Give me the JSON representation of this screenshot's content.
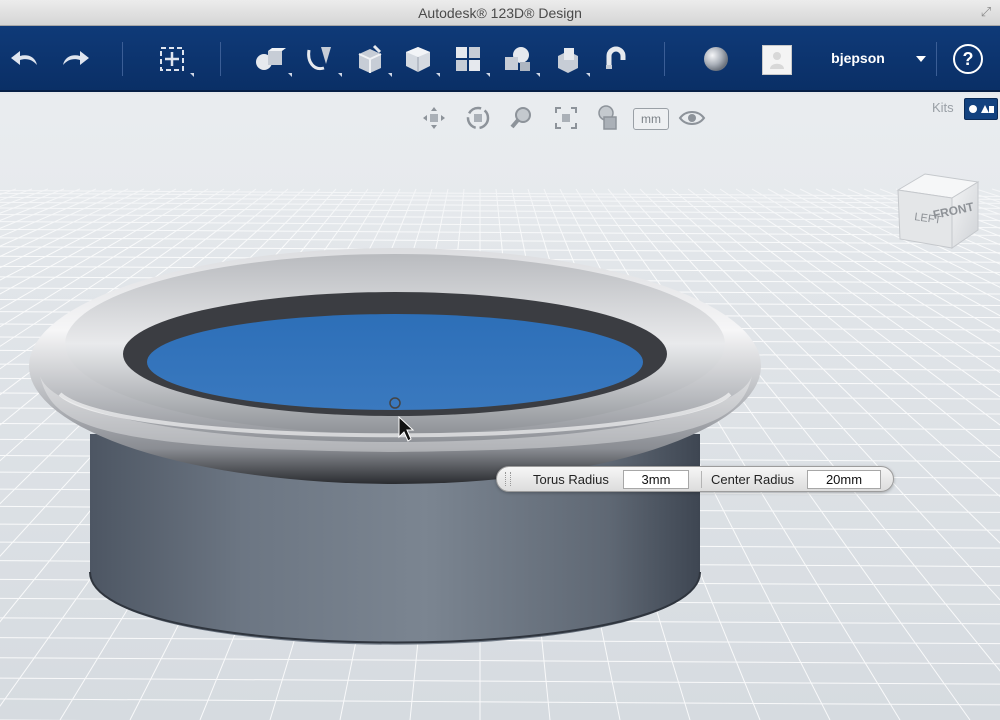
{
  "window": {
    "title": "Autodesk® 123D® Design"
  },
  "toolbar": {
    "undo_icon": "undo-arrow-icon",
    "redo_icon": "redo-arrow-icon",
    "transform_icon": "transform-move-icon",
    "primitives_icon": "primitives-icon",
    "sketch_icon": "sketch-icon",
    "construct_icon": "construct-icon",
    "modify_icon": "modify-icon",
    "pattern_icon": "pattern-icon",
    "grouping_icon": "grouping-icon",
    "combine_icon": "combine-icon",
    "snap_icon": "snap-magnet-icon",
    "material_icon": "material-sphere-icon",
    "username": "bjepson",
    "help_label": "?"
  },
  "view_tools": {
    "mm_label": "mm",
    "kits_label": "Kits"
  },
  "viewcube": {
    "left_label": "LEFT",
    "front_label": "FRONT"
  },
  "params": {
    "torus_radius_label": "Torus Radius",
    "torus_radius_value": "3mm",
    "center_radius_label": "Center Radius",
    "center_radius_value": "20mm"
  },
  "colors": {
    "toolbar_blue": "#0f3a78",
    "cylinder_blue": "#2d6fb8",
    "torus_gray": "#c8c9cc",
    "body_gray": "#6e7784"
  }
}
